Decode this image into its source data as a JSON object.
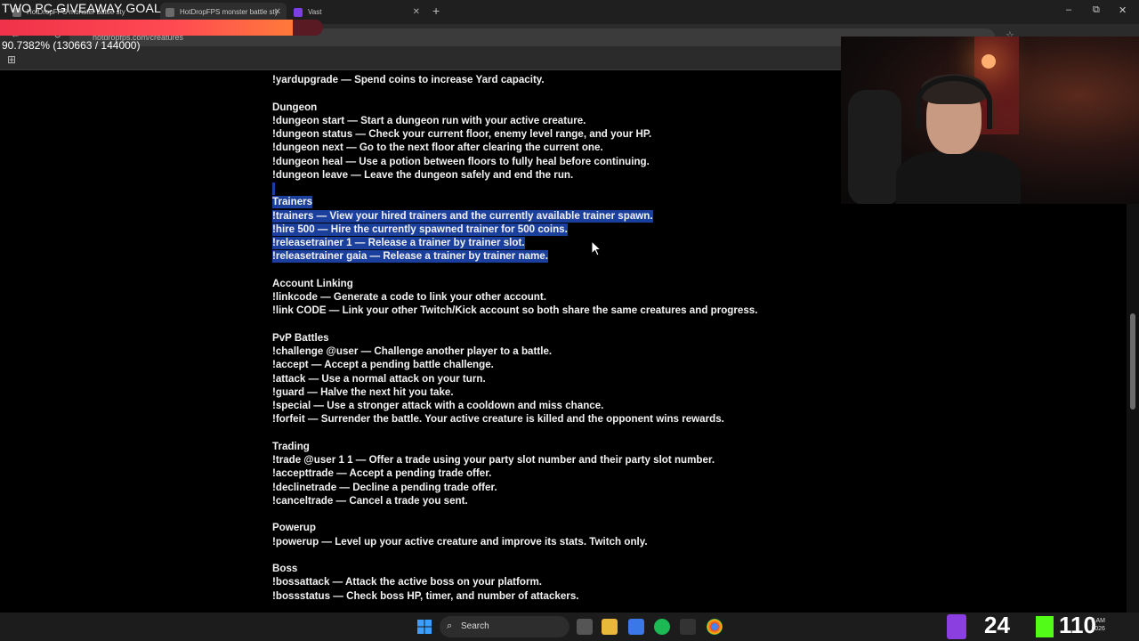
{
  "browser": {
    "tabs": [
      {
        "label": "HotDropFPS monster battle sty"
      },
      {
        "label": "HotDropFPS monster battle sty"
      },
      {
        "label": "Vast"
      }
    ],
    "new_tab_label": "+",
    "url": "hotdropfps.com/creatures",
    "window_controls": {
      "minimize": "–",
      "maximize": "⧉",
      "close": "✕"
    }
  },
  "overlay": {
    "goal_title": "TWO PC GIVEAWAY GOAL",
    "goal_stats": "90.7382% (130663 / 144000)",
    "goal_progress": 0.907382,
    "colors": {
      "fill_start": "#f0324a",
      "fill_end": "#ff7a3a"
    }
  },
  "content": {
    "lines": [
      {
        "text": "!yardupgrade — Spend coins to increase Yard capacity.",
        "highlight": false
      },
      {
        "text": "",
        "highlight": false
      },
      {
        "text": "Dungeon",
        "highlight": false
      },
      {
        "text": "!dungeon start — Start a dungeon run with your active creature.",
        "highlight": false
      },
      {
        "text": "!dungeon status — Check your current floor, enemy level range, and your HP.",
        "highlight": false
      },
      {
        "text": "!dungeon next — Go to the next floor after clearing the current one.",
        "highlight": false
      },
      {
        "text": "!dungeon heal — Use a potion between floors to fully heal before continuing.",
        "highlight": false
      },
      {
        "text": "!dungeon leave — Leave the dungeon safely and end the run.",
        "highlight": false
      },
      {
        "text": " ",
        "highlight": true
      },
      {
        "text": "Trainers",
        "highlight": true
      },
      {
        "text": "!trainers — View your hired trainers and the currently available trainer spawn.",
        "highlight": true
      },
      {
        "text": "!hire 500 — Hire the currently spawned trainer for 500 coins.",
        "highlight": true
      },
      {
        "text": "!releasetrainer 1 — Release a trainer by trainer slot.",
        "highlight": true
      },
      {
        "text": "!releasetrainer gaia — Release a trainer by trainer name.",
        "highlight": true
      },
      {
        "text": "",
        "highlight": false
      },
      {
        "text": "Account Linking",
        "highlight": false
      },
      {
        "text": "!linkcode — Generate a code to link your other account.",
        "highlight": false
      },
      {
        "text": "!link CODE — Link your other Twitch/Kick account so both share the same creatures and progress.",
        "highlight": false
      },
      {
        "text": "",
        "highlight": false
      },
      {
        "text": "PvP Battles",
        "highlight": false
      },
      {
        "text": "!challenge @user — Challenge another player to a battle.",
        "highlight": false
      },
      {
        "text": "!accept — Accept a pending battle challenge.",
        "highlight": false
      },
      {
        "text": "!attack — Use a normal attack on your turn.",
        "highlight": false
      },
      {
        "text": "!guard — Halve the next hit you take.",
        "highlight": false
      },
      {
        "text": "!special — Use a stronger attack with a cooldown and miss chance.",
        "highlight": false
      },
      {
        "text": "!forfeit — Surrender the battle. Your active creature is killed and the opponent wins rewards.",
        "highlight": false
      },
      {
        "text": "",
        "highlight": false
      },
      {
        "text": "Trading",
        "highlight": false
      },
      {
        "text": "!trade @user 1 1 — Offer a trade using your party slot number and their party slot number.",
        "highlight": false
      },
      {
        "text": "!accepttrade — Accept a pending trade offer.",
        "highlight": false
      },
      {
        "text": "!declinetrade — Decline a pending trade offer.",
        "highlight": false
      },
      {
        "text": "!canceltrade — Cancel a trade you sent.",
        "highlight": false
      },
      {
        "text": "",
        "highlight": false
      },
      {
        "text": "Powerup",
        "highlight": false
      },
      {
        "text": "!powerup — Level up your active creature and improve its stats. Twitch only.",
        "highlight": false
      },
      {
        "text": "",
        "highlight": false
      },
      {
        "text": "Boss",
        "highlight": false
      },
      {
        "text": "!bossattack — Attack the active boss on your platform.",
        "highlight": false
      },
      {
        "text": "!bossstatus — Check boss HP, timer, and number of attackers.",
        "highlight": false
      }
    ],
    "highlight_color": "#1b3f9c"
  },
  "taskbar": {
    "search_label": "Search",
    "twitch_viewers": "24",
    "kick_viewers": "110",
    "clock_time": "5 AM",
    "clock_year": "2026",
    "colors": {
      "twitch": "#8b3fe0",
      "kick": "#53fc18"
    }
  }
}
